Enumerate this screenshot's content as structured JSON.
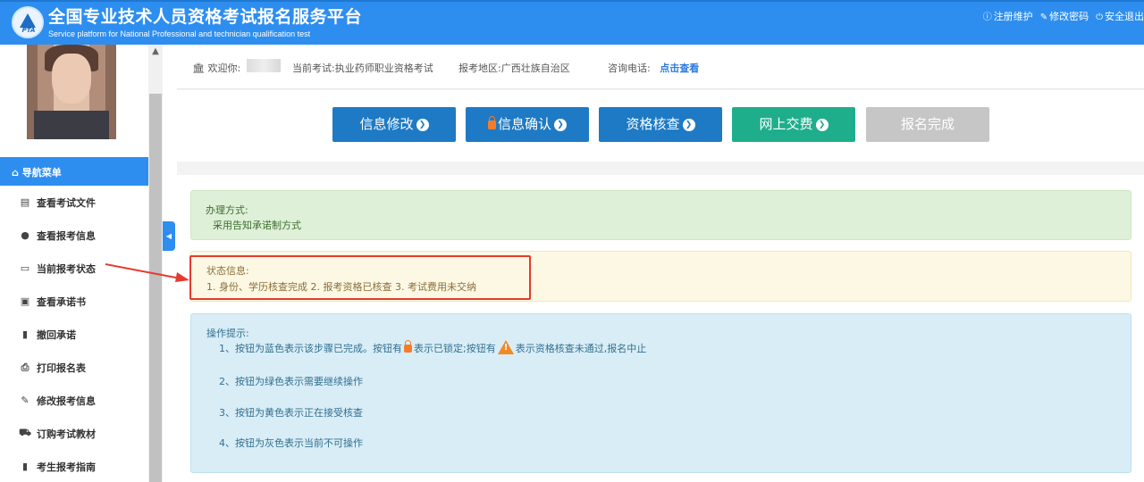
{
  "header": {
    "title": "全国专业技术人员资格考试报名服务平台",
    "subtitle": "Service platform for National Professional and technician qualification test",
    "logo_text": "PTA",
    "links": [
      {
        "icon": "info-icon",
        "label": "注册维护"
      },
      {
        "icon": "edit-icon",
        "label": "修改密码"
      },
      {
        "icon": "power-icon",
        "label": "安全退出"
      }
    ]
  },
  "sidebar": {
    "nav_header": "导航菜单",
    "items": [
      {
        "icon": "file-icon",
        "label": "查看考试文件"
      },
      {
        "icon": "info-circle-icon",
        "label": "查看报考信息"
      },
      {
        "icon": "monitor-icon",
        "label": "当前报考状态"
      },
      {
        "icon": "id-card-icon",
        "label": "查看承诺书"
      },
      {
        "icon": "book-icon",
        "label": "撤回承诺"
      },
      {
        "icon": "print-icon",
        "label": "打印报名表"
      },
      {
        "icon": "edit-icon",
        "label": "修改报考信息"
      },
      {
        "icon": "cart-icon",
        "label": "订购考试教材"
      },
      {
        "icon": "book-icon",
        "label": "考生报考指南"
      }
    ]
  },
  "infobar": {
    "welcome_label": "欢迎你:",
    "exam_label": "当前考试:",
    "exam_value": "执业药师职业资格考试",
    "region_label": "报考地区:",
    "region_value": "广西壮族自治区",
    "phone_label": "咨询电话:",
    "phone_link": "点击查看"
  },
  "steps": [
    {
      "label": "信息修改",
      "color": "#1e7ac4",
      "locked": false,
      "arrow": true
    },
    {
      "label": "信息确认",
      "color": "#1e7ac4",
      "locked": true,
      "arrow": true
    },
    {
      "label": "资格核查",
      "color": "#1e7ac4",
      "locked": false,
      "arrow": true
    },
    {
      "label": "网上交费",
      "color": "#1fae8c",
      "locked": false,
      "arrow": true
    },
    {
      "label": "报名完成",
      "color": "#c6c6c6",
      "locked": false,
      "arrow": false
    }
  ],
  "method": {
    "title": "办理方式:",
    "value": "采用告知承诺制方式"
  },
  "status": {
    "title": "状态信息:",
    "value": "1. 身份、学历核查完成 2. 报考资格已核查 3. 考试费用未交纳"
  },
  "tips": {
    "title": "操作提示:",
    "line1_a": "1、按钮为蓝色表示该步骤已完成。按钮有",
    "line1_b": "表示已锁定;按钮有",
    "line1_c": "表示资格核查未通过,报名中止",
    "line2": "2、按钮为绿色表示需要继续操作",
    "line3": "3、按钮为黄色表示正在接受核查",
    "line4": "4、按钮为灰色表示当前不可操作"
  },
  "colors": {
    "brand": "#2d8ef0",
    "annotation": "#e53a2f"
  }
}
